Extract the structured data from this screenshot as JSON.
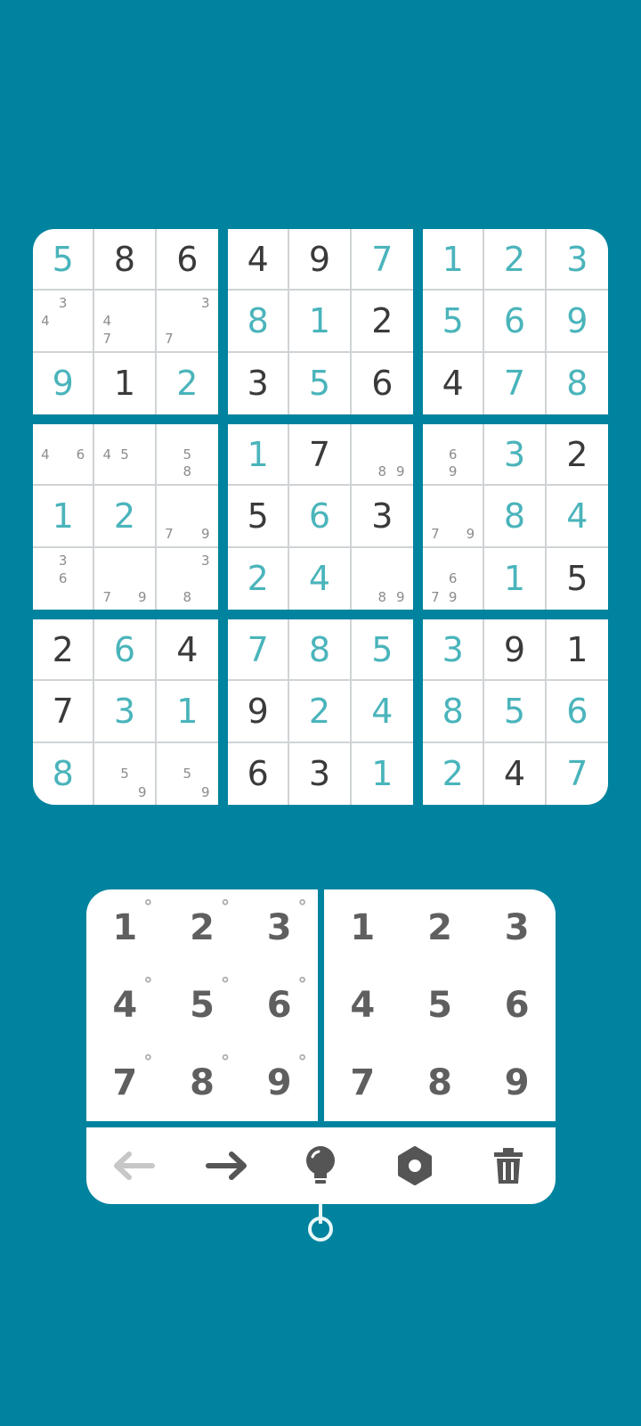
{
  "board": {
    "boxes": [
      {
        "cells": [
          {
            "v": "5",
            "t": "entered"
          },
          {
            "v": "8",
            "t": "given"
          },
          {
            "v": "6",
            "t": "given"
          },
          {
            "notes": [
              "",
              "3",
              "",
              "4",
              "",
              "",
              "",
              "",
              ""
            ]
          },
          {
            "notes": [
              "",
              "",
              "",
              "4",
              "",
              "",
              "7",
              "",
              ""
            ]
          },
          {
            "notes": [
              "",
              "",
              "3",
              "",
              "",
              "",
              "7",
              "",
              ""
            ]
          },
          {
            "v": "9",
            "t": "entered"
          },
          {
            "v": "1",
            "t": "given"
          },
          {
            "v": "2",
            "t": "entered"
          }
        ]
      },
      {
        "cells": [
          {
            "v": "4",
            "t": "given"
          },
          {
            "v": "9",
            "t": "given"
          },
          {
            "v": "7",
            "t": "entered"
          },
          {
            "v": "8",
            "t": "entered"
          },
          {
            "v": "1",
            "t": "entered"
          },
          {
            "v": "2",
            "t": "given"
          },
          {
            "v": "3",
            "t": "given"
          },
          {
            "v": "5",
            "t": "entered"
          },
          {
            "v": "6",
            "t": "given"
          }
        ]
      },
      {
        "cells": [
          {
            "v": "1",
            "t": "entered"
          },
          {
            "v": "2",
            "t": "entered"
          },
          {
            "v": "3",
            "t": "entered"
          },
          {
            "v": "5",
            "t": "entered"
          },
          {
            "v": "6",
            "t": "entered"
          },
          {
            "v": "9",
            "t": "entered"
          },
          {
            "v": "4",
            "t": "given"
          },
          {
            "v": "7",
            "t": "entered"
          },
          {
            "v": "8",
            "t": "entered"
          }
        ]
      },
      {
        "cells": [
          {
            "notes": [
              "",
              "",
              "",
              "4",
              "",
              "6",
              "",
              "",
              ""
            ]
          },
          {
            "notes": [
              "",
              "",
              "",
              "4",
              "5",
              "",
              "",
              "",
              ""
            ]
          },
          {
            "notes": [
              "",
              "",
              "",
              "",
              "5",
              "",
              "",
              "8",
              ""
            ]
          },
          {
            "v": "1",
            "t": "entered"
          },
          {
            "v": "2",
            "t": "entered"
          },
          {
            "notes": [
              "",
              "",
              "",
              "",
              "",
              "",
              "7",
              "",
              "9"
            ]
          },
          {
            "notes": [
              "",
              "3",
              "",
              "",
              "6",
              "",
              "",
              "",
              ""
            ]
          },
          {
            "notes": [
              "",
              "",
              "",
              "",
              "",
              "",
              "7",
              "",
              "9"
            ]
          },
          {
            "notes": [
              "",
              "",
              "3",
              "",
              "",
              "",
              "",
              "8",
              ""
            ]
          }
        ]
      },
      {
        "cells": [
          {
            "v": "1",
            "t": "entered"
          },
          {
            "v": "7",
            "t": "given"
          },
          {
            "notes": [
              "",
              "",
              "",
              "",
              "",
              "",
              "",
              "8",
              "9"
            ]
          },
          {
            "v": "5",
            "t": "given"
          },
          {
            "v": "6",
            "t": "entered"
          },
          {
            "v": "3",
            "t": "given"
          },
          {
            "v": "2",
            "t": "entered"
          },
          {
            "v": "4",
            "t": "entered"
          },
          {
            "notes": [
              "",
              "",
              "",
              "",
              "",
              "",
              "",
              "8",
              "9"
            ]
          }
        ]
      },
      {
        "cells": [
          {
            "notes": [
              "",
              "",
              "",
              "",
              "6",
              "",
              "",
              "9",
              ""
            ]
          },
          {
            "v": "3",
            "t": "entered"
          },
          {
            "v": "2",
            "t": "given"
          },
          {
            "notes": [
              "",
              "",
              "",
              "",
              "",
              "",
              "7",
              "",
              "9"
            ]
          },
          {
            "v": "8",
            "t": "entered"
          },
          {
            "v": "4",
            "t": "entered"
          },
          {
            "notes": [
              "",
              "",
              "",
              "",
              "6",
              "",
              "7",
              "9",
              ""
            ]
          },
          {
            "v": "1",
            "t": "entered"
          },
          {
            "v": "5",
            "t": "given"
          }
        ]
      },
      {
        "cells": [
          {
            "v": "2",
            "t": "given"
          },
          {
            "v": "6",
            "t": "entered"
          },
          {
            "v": "4",
            "t": "given"
          },
          {
            "v": "7",
            "t": "given"
          },
          {
            "v": "3",
            "t": "entered"
          },
          {
            "v": "1",
            "t": "entered"
          },
          {
            "v": "8",
            "t": "entered"
          },
          {
            "notes": [
              "",
              "",
              "",
              "",
              "5",
              "",
              "",
              "",
              "9"
            ]
          },
          {
            "notes": [
              "",
              "",
              "",
              "",
              "5",
              "",
              "",
              "",
              "9"
            ]
          }
        ]
      },
      {
        "cells": [
          {
            "v": "7",
            "t": "entered"
          },
          {
            "v": "8",
            "t": "entered"
          },
          {
            "v": "5",
            "t": "entered"
          },
          {
            "v": "9",
            "t": "given"
          },
          {
            "v": "2",
            "t": "entered"
          },
          {
            "v": "4",
            "t": "entered"
          },
          {
            "v": "6",
            "t": "given"
          },
          {
            "v": "3",
            "t": "given"
          },
          {
            "v": "1",
            "t": "entered"
          }
        ]
      },
      {
        "cells": [
          {
            "v": "3",
            "t": "entered"
          },
          {
            "v": "9",
            "t": "given"
          },
          {
            "v": "1",
            "t": "given"
          },
          {
            "v": "8",
            "t": "entered"
          },
          {
            "v": "5",
            "t": "entered"
          },
          {
            "v": "6",
            "t": "entered"
          },
          {
            "v": "2",
            "t": "entered"
          },
          {
            "v": "4",
            "t": "given"
          },
          {
            "v": "7",
            "t": "entered"
          }
        ]
      }
    ]
  },
  "pencil_keys": [
    "1",
    "2",
    "3",
    "4",
    "5",
    "6",
    "7",
    "8",
    "9"
  ],
  "pencil_mark": "°",
  "number_keys": [
    "1",
    "2",
    "3",
    "4",
    "5",
    "6",
    "7",
    "8",
    "9"
  ],
  "toolbar": {
    "icons": [
      "undo-arrow-icon",
      "redo-arrow-icon",
      "hint-bulb-icon",
      "settings-gear-icon",
      "trash-icon"
    ]
  },
  "colors": {
    "background": "#00839e",
    "given_digit": "#3a3a3a",
    "entered_digit": "#4ab4bb",
    "note_digit": "#8c8c8c"
  }
}
